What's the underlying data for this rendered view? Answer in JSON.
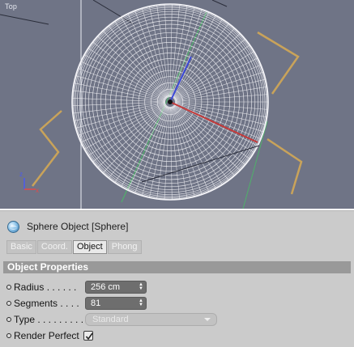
{
  "viewport": {
    "view_label": "Top",
    "axis_labels": {
      "y": "z",
      "x": "x"
    },
    "colors": {
      "background": "#6f7486",
      "wire": "#f4f4f8",
      "guide": "#c9a35a"
    }
  },
  "attributes": {
    "object_title": "Sphere Object [Sphere]",
    "object_icon": "sphere-icon",
    "tabs": [
      {
        "label": "Basic",
        "active": false
      },
      {
        "label": "Coord.",
        "active": false
      },
      {
        "label": "Object",
        "active": true
      },
      {
        "label": "Phong",
        "active": false
      }
    ],
    "section_title": "Object Properties",
    "properties": {
      "radius": {
        "label": "Radius . . . . . .",
        "value": "256 cm"
      },
      "segments": {
        "label": "Segments . . . .",
        "value": "81"
      },
      "type": {
        "label": "Type . . . . . . . . .",
        "value": "Standard"
      },
      "render_perfect": {
        "label": "Render Perfect",
        "checked": true
      }
    }
  }
}
